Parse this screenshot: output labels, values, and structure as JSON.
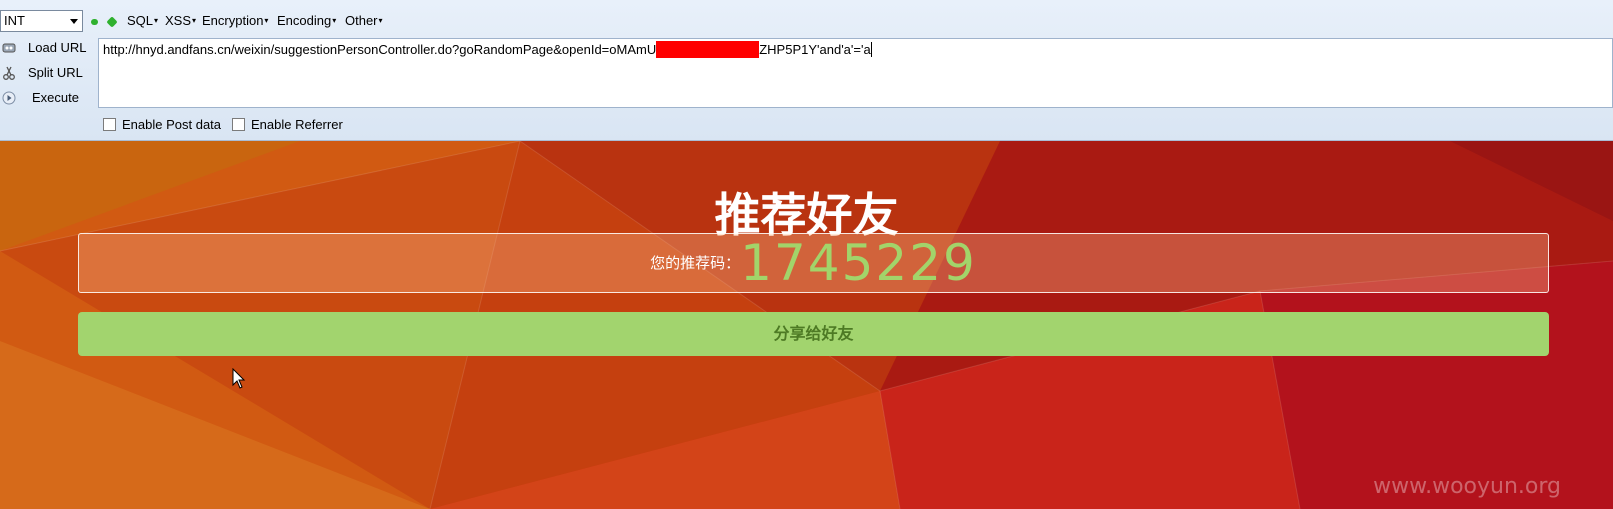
{
  "toolbar": {
    "select_value": "INT",
    "menus": [
      {
        "label": "SQL"
      },
      {
        "label": "XSS"
      },
      {
        "label": "Encryption"
      },
      {
        "label": "Encoding"
      },
      {
        "label": "Other"
      }
    ],
    "actions": {
      "load_url": "Load URL",
      "split_url": "Split URL",
      "execute": "Execute"
    },
    "url": {
      "prefix": "http://hnyd.andfans.cn/weixin/suggestionPersonController.do?goRandomPage&openId=oMAmU",
      "suffix": "ZHP5P1Y'and'a'='a"
    },
    "checkboxes": {
      "post_data": "Enable Post data",
      "referrer": "Enable Referrer"
    }
  },
  "page": {
    "title": "推荐好友",
    "code_label": "您的推荐码：",
    "code_value": "1745229",
    "share_button": "分享给好友",
    "watermark": "www.wooyun.org"
  },
  "colors": {
    "accent_green": "#a2d46e",
    "redaction": "#ff0000"
  }
}
